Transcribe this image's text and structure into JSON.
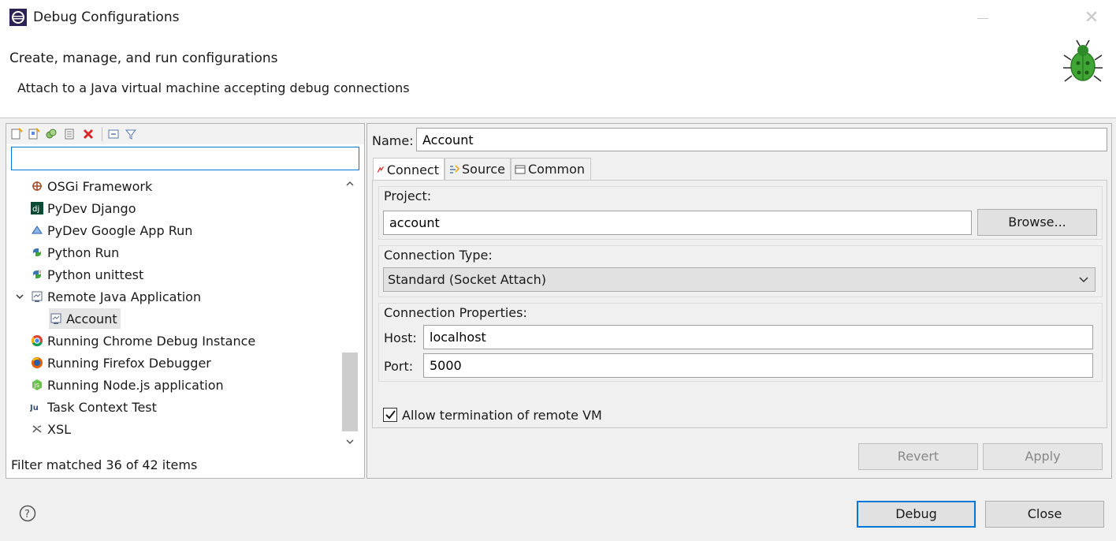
{
  "window": {
    "title": "Debug Configurations",
    "close_glyph": "✕"
  },
  "header": {
    "title": "Create, manage, and run configurations",
    "subtitle": "Attach to a Java virtual machine accepting debug connections",
    "icon": "bug-icon"
  },
  "left_pane": {
    "toolbar_icons": [
      "new-config-icon",
      "new-prototype-icon",
      "duplicate-icon",
      "export-icon",
      "delete-icon",
      "collapse-all-icon",
      "filter-icon"
    ],
    "filter_value": "",
    "tree": [
      {
        "label": "OSGi Framework",
        "icon": "osgi-icon",
        "level": 0
      },
      {
        "label": "PyDev Django",
        "icon": "django-icon",
        "level": 0
      },
      {
        "label": "PyDev Google App Run",
        "icon": "google-app-icon",
        "level": 0
      },
      {
        "label": "Python Run",
        "icon": "python-icon",
        "level": 0
      },
      {
        "label": "Python unittest",
        "icon": "python-unittest-icon",
        "level": 0
      },
      {
        "label": "Remote Java Application",
        "icon": "remote-java-icon",
        "level": 0,
        "expanded": true
      },
      {
        "label": "Account",
        "icon": "remote-java-icon",
        "level": 1,
        "selected": true
      },
      {
        "label": "Running Chrome Debug Instance",
        "icon": "chrome-icon",
        "level": 0
      },
      {
        "label": "Running Firefox Debugger",
        "icon": "firefox-icon",
        "level": 0
      },
      {
        "label": "Running Node.js application",
        "icon": "nodejs-icon",
        "level": 0
      },
      {
        "label": "Task Context Test",
        "icon": "junit-icon",
        "level": 0
      },
      {
        "label": "XSL",
        "icon": "xsl-icon",
        "level": 0
      }
    ],
    "status": "Filter matched 36 of 42 items",
    "scroll_up": "⌃",
    "scroll_down": "⌄"
  },
  "right_pane": {
    "name_label": "Name:",
    "name_value": "Account",
    "tabs": [
      {
        "label": "Connect",
        "icon": "connect-icon",
        "active": true
      },
      {
        "label": "Source",
        "icon": "source-icon",
        "active": false
      },
      {
        "label": "Common",
        "icon": "common-icon",
        "active": false
      }
    ],
    "project_label": "Project:",
    "project_value": "account",
    "browse_label": "Browse...",
    "connection_type_label": "Connection Type:",
    "connection_type_value": "Standard (Socket Attach)",
    "connection_props_label": "Connection Properties:",
    "host_label": "Host:",
    "host_value": "localhost",
    "port_label": "Port:",
    "port_value": "5000",
    "allow_termination_label": "Allow termination of remote VM",
    "allow_termination_checked": true,
    "revert_label": "Revert",
    "apply_label": "Apply"
  },
  "footer": {
    "help_glyph": "?",
    "debug_label": "Debug",
    "close_label": "Close"
  },
  "colors": {
    "accent": "#0078d7",
    "delete_red": "#d62828",
    "bug_green": "#3fa535"
  }
}
